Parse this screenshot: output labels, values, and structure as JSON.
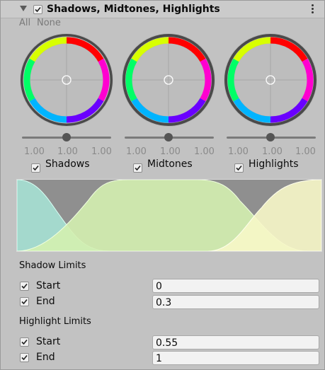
{
  "header": {
    "title": "Shadows, Midtones, Highlights",
    "enabled": true
  },
  "selection": {
    "all_label": "All",
    "none_label": "None"
  },
  "wheels": [
    {
      "label": "Shadows",
      "values": [
        "1.00",
        "1.00",
        "1.00"
      ],
      "checked": true,
      "slider": 0.5
    },
    {
      "label": "Midtones",
      "values": [
        "1.00",
        "1.00",
        "1.00"
      ],
      "checked": true,
      "slider": 0.5
    },
    {
      "label": "Highlights",
      "values": [
        "1.00",
        "1.00",
        "1.00"
      ],
      "checked": true,
      "slider": 0.5
    }
  ],
  "shadow_limits": {
    "title": "Shadow Limits",
    "start": {
      "label": "Start",
      "value": "0"
    },
    "end": {
      "label": "End",
      "value": "0.3"
    }
  },
  "highlight_limits": {
    "title": "Highlight Limits",
    "start": {
      "label": "Start",
      "value": "0.55"
    },
    "end": {
      "label": "End",
      "value": "1"
    }
  },
  "colors": {
    "shadow_curve": "#a8e6d8",
    "midtone_curve": "#d4f0b0",
    "highlight_curve": "#f7f7c8",
    "background": "#c2c2c2"
  }
}
